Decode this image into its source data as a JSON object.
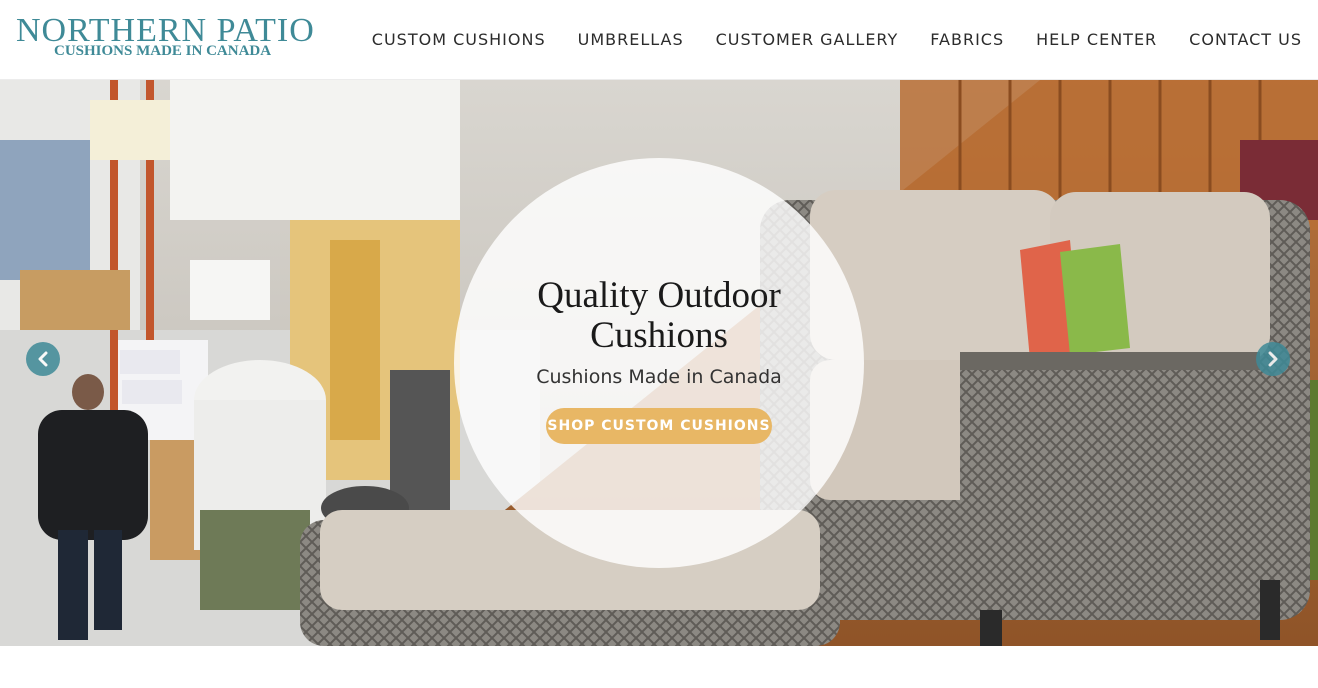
{
  "brand": {
    "name": "NORTHERN PATIO",
    "tagline": "CUSHIONS MADE IN CANADA",
    "color": "#3f8a97"
  },
  "nav": {
    "items": [
      {
        "label": "CUSTOM CUSHIONS"
      },
      {
        "label": "UMBRELLAS"
      },
      {
        "label": "CUSTOMER GALLERY"
      },
      {
        "label": "FABRICS"
      },
      {
        "label": "HELP CENTER"
      },
      {
        "label": "CONTACT US"
      }
    ]
  },
  "hero": {
    "title": "Quality Outdoor Cushions",
    "subtitle": "Cushions Made in Canada",
    "cta_label": "SHOP CUSTOM CUSHIONS",
    "cta_color": "#e8b765",
    "prev_icon": "chevron-left-icon",
    "next_icon": "chevron-right-icon"
  }
}
